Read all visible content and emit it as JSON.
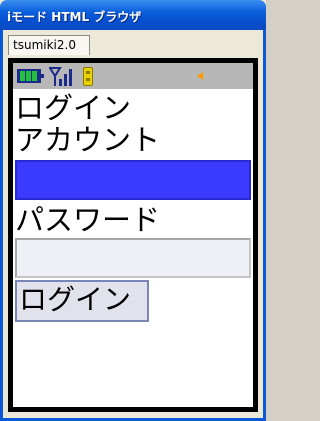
{
  "window": {
    "title": "iモード HTML ブラウザ"
  },
  "tabs": [
    {
      "label": "tsumiki2.0"
    }
  ],
  "status_bar": {
    "icons": [
      "battery-icon",
      "signal-icon",
      "phone-icon",
      "arrow-left-icon"
    ],
    "colors": {
      "background": "#b7b7b7",
      "battery": "#22c040",
      "signal": "#1c2a8a",
      "phone": "#e8d200",
      "arrow": "#ff9900"
    }
  },
  "page": {
    "heading": "ログイン",
    "account_label": "アカウント",
    "account_value": "",
    "password_label": "パスワード",
    "password_value": "",
    "login_button": "ログイン"
  },
  "colors": {
    "titlebar": "#0a5fdc",
    "account_input_focus": "#3b3bff",
    "password_input_bg": "#eef0f6",
    "button_bg": "#e2e2ec"
  }
}
